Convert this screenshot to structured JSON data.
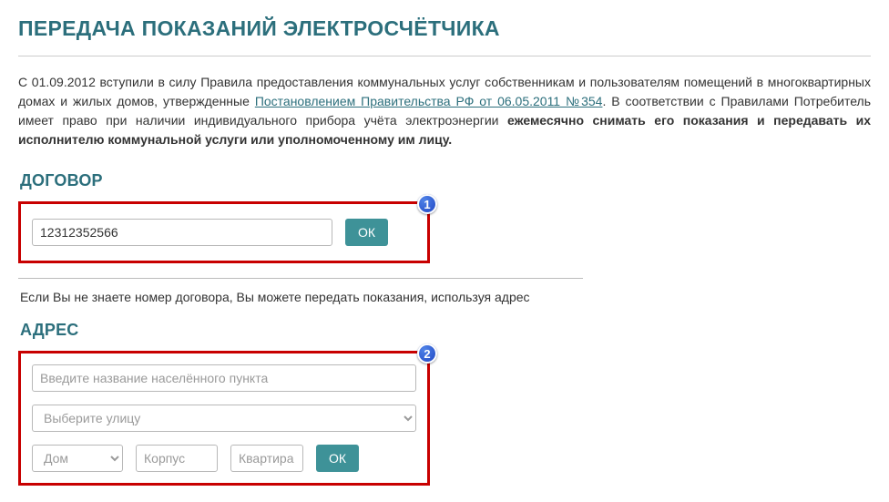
{
  "pageTitle": "ПЕРЕДАЧА ПОКАЗАНИЙ ЭЛЕКТРОСЧЁТЧИКА",
  "intro": {
    "prefix": "С 01.09.2012 вступили в силу Правила предоставления коммунальных услуг собственникам и пользователям помещений в многоквартирных домах и жилых домов, утвержденные ",
    "linkText": "Постановлением Правительства РФ от 06.05.2011 №354",
    "middle": ". В соответствии с Правилами Потребитель имеет право при наличии индивидуального прибора учёта электроэнергии ",
    "bold": "ежемесячно снимать его показания и передавать их исполнителю коммунальной услуги или уполномоченному им лицу."
  },
  "contract": {
    "title": "ДОГОВОР",
    "inputValue": "12312352566",
    "okLabel": "ОК",
    "badge": "1"
  },
  "note": "Если Вы не знаете номер договора, Вы можете передать показания, используя адрес",
  "address": {
    "title": "АДРЕС",
    "badge": "2",
    "cityPlaceholder": "Введите название населённого пункта",
    "streetPlaceholder": "Выберите улицу",
    "housePlaceholder": "Дом",
    "blockPlaceholder": "Корпус",
    "flatPlaceholder": "Квартира",
    "okLabel": "ОК"
  }
}
